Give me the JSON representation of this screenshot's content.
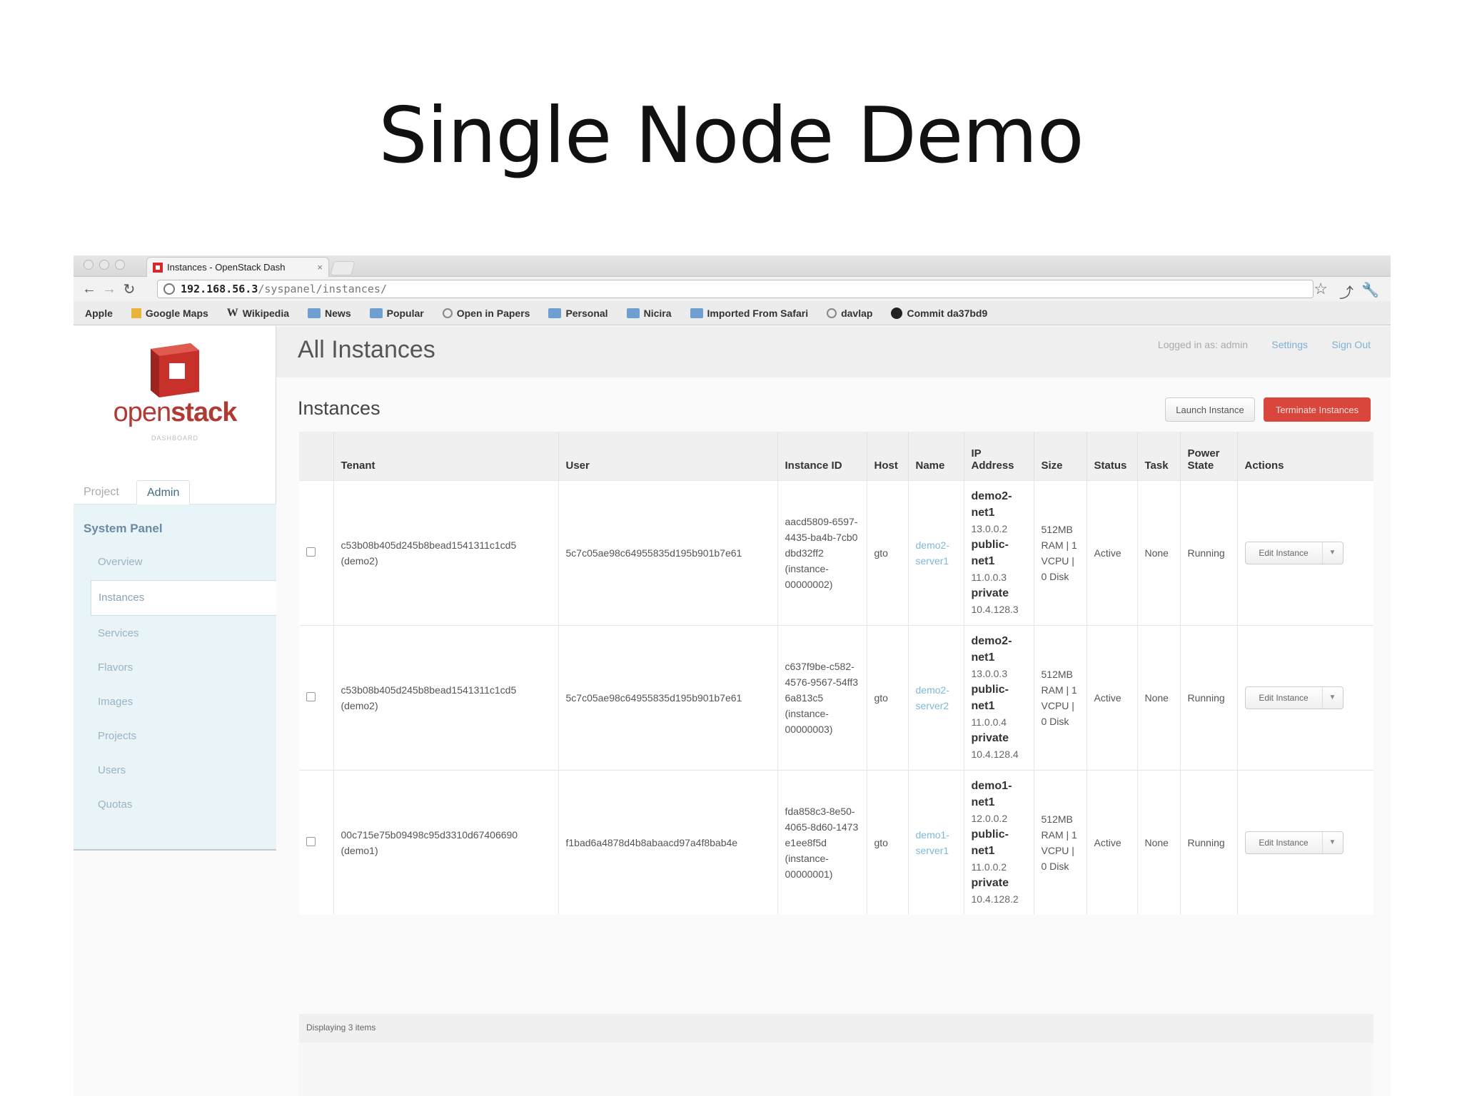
{
  "slide": {
    "title": "Single Node Demo"
  },
  "browser": {
    "tab_title": "Instances - OpenStack Dash",
    "tab_close": "×",
    "url_host": "192.168.56.3",
    "url_path": "/syspanel/instances/",
    "bookmarks": [
      {
        "label": "Apple",
        "icon": "apple-icon"
      },
      {
        "label": "Google Maps",
        "icon": "maps-icon"
      },
      {
        "label": "Wikipedia",
        "icon": "wikipedia-icon"
      },
      {
        "label": "News",
        "icon": "folder-icon"
      },
      {
        "label": "Popular",
        "icon": "folder-icon"
      },
      {
        "label": "Open in Papers",
        "icon": "globe-icon"
      },
      {
        "label": "Personal",
        "icon": "folder-icon"
      },
      {
        "label": "Nicira",
        "icon": "folder-icon"
      },
      {
        "label": "Imported From Safari",
        "icon": "folder-icon"
      },
      {
        "label": "davlap",
        "icon": "globe-icon"
      },
      {
        "label": "Commit da37bd9",
        "icon": "github-icon"
      }
    ]
  },
  "sidebar": {
    "logo_text_a": "open",
    "logo_text_b": "stack",
    "logo_sub": "DASHBOARD",
    "tabs": {
      "project": "Project",
      "admin": "Admin"
    },
    "panel_heading": "System Panel",
    "items": [
      "Overview",
      "Instances",
      "Services",
      "Flavors",
      "Images",
      "Projects",
      "Users",
      "Quotas"
    ]
  },
  "header": {
    "title": "All Instances",
    "logged_in": "Logged in as: admin",
    "settings": "Settings",
    "sign_out": "Sign Out"
  },
  "instances": {
    "title": "Instances",
    "launch_button": "Launch Instance",
    "terminate_button": "Terminate Instances",
    "columns": [
      "Tenant",
      "User",
      "Instance ID",
      "Host",
      "Name",
      "IP Address",
      "Size",
      "Status",
      "Task",
      "Power State",
      "Actions"
    ],
    "rows": [
      {
        "tenant": "c53b08b405d245b8bead1541311c1cd5",
        "tenant_name": "(demo2)",
        "user": "5c7c05ae98c64955835d195b901b7e61",
        "instance_id": "aacd5809-6597-4435-ba4b-7cb0dbd32ff2",
        "instance_name": "(instance-00000002)",
        "host": "gto",
        "name": "demo2-server1",
        "ip": [
          {
            "net": "demo2-net1",
            "addr": "13.0.0.2"
          },
          {
            "net": "public-net1",
            "addr": "11.0.0.3"
          },
          {
            "net": "private",
            "addr": "10.4.128.3"
          }
        ],
        "size": "512MB RAM | 1 VCPU | 0 Disk",
        "status": "Active",
        "task": "None",
        "power": "Running",
        "action": "Edit Instance"
      },
      {
        "tenant": "c53b08b405d245b8bead1541311c1cd5",
        "tenant_name": "(demo2)",
        "user": "5c7c05ae98c64955835d195b901b7e61",
        "instance_id": "c637f9be-c582-4576-9567-54ff36a813c5",
        "instance_name": "(instance-00000003)",
        "host": "gto",
        "name": "demo2-server2",
        "ip": [
          {
            "net": "demo2-net1",
            "addr": "13.0.0.3"
          },
          {
            "net": "public-net1",
            "addr": "11.0.0.4"
          },
          {
            "net": "private",
            "addr": "10.4.128.4"
          }
        ],
        "size": "512MB RAM | 1 VCPU | 0 Disk",
        "status": "Active",
        "task": "None",
        "power": "Running",
        "action": "Edit Instance"
      },
      {
        "tenant": "00c715e75b09498c95d3310d67406690",
        "tenant_name": "(demo1)",
        "user": "f1bad6a4878d4b8abaacd97a4f8bab4e",
        "instance_id": "fda858c3-8e50-4065-8d60-1473e1ee8f5d",
        "instance_name": "(instance-00000001)",
        "host": "gto",
        "name": "demo1-server1",
        "ip": [
          {
            "net": "demo1-net1",
            "addr": "12.0.0.2"
          },
          {
            "net": "public-net1",
            "addr": "11.0.0.2"
          },
          {
            "net": "private",
            "addr": "10.4.128.2"
          }
        ],
        "size": "512MB RAM | 1 VCPU | 0 Disk",
        "status": "Active",
        "task": "None",
        "power": "Running",
        "action": "Edit Instance"
      }
    ],
    "footer": "Displaying 3 items"
  },
  "colors": {
    "brand": "#b03a34",
    "danger": "#d9463b",
    "link": "#7fb8d8"
  }
}
